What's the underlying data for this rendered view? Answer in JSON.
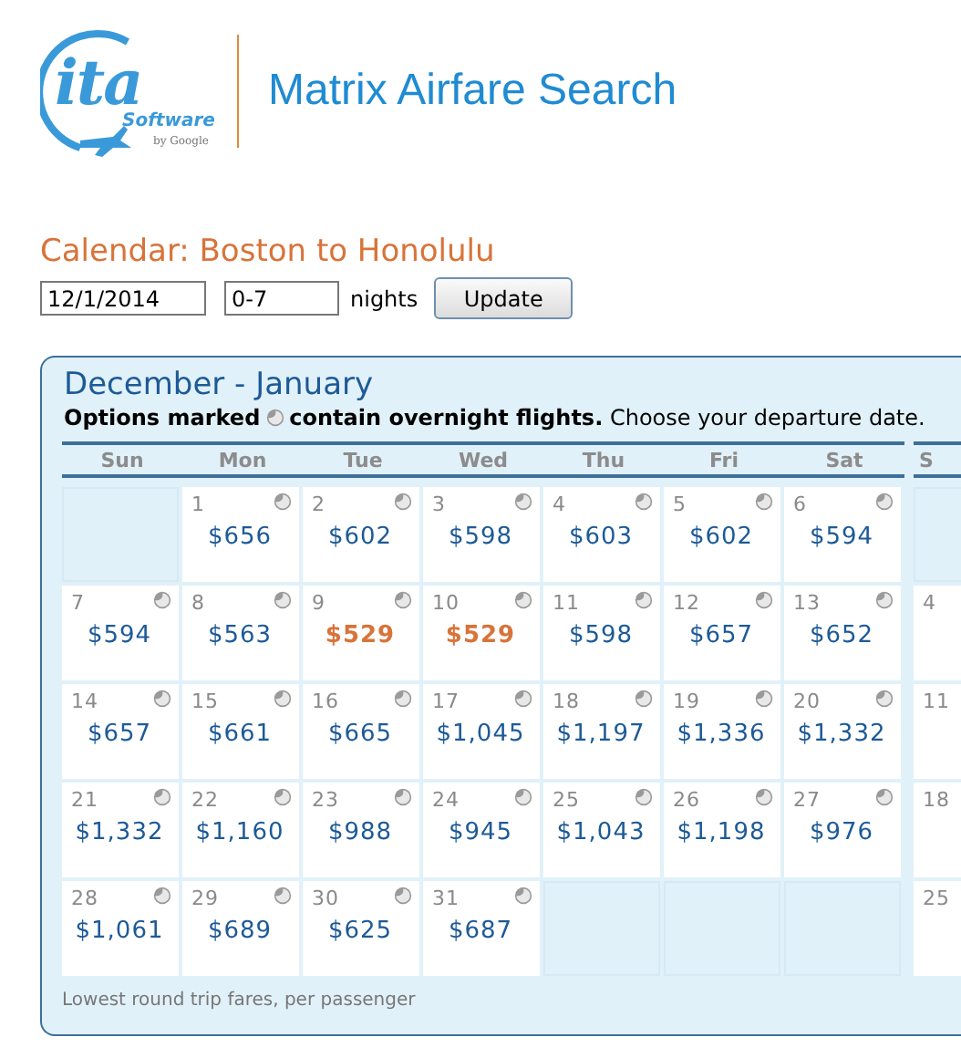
{
  "header": {
    "logo": {
      "wordmark": "ita",
      "product": "Software",
      "owner": "by Google"
    },
    "title": "Matrix Airfare Search"
  },
  "search": {
    "heading": "Calendar: Boston to Honolulu",
    "date": "12/1/2014",
    "nights": "0-7",
    "nights_label": "nights",
    "button": "Update"
  },
  "calendar": {
    "title": "December - January",
    "legend": {
      "lead": "Options marked",
      "rest": "**contain overnight flights.** Choose your departure date."
    },
    "weekdays": [
      "Sun",
      "Mon",
      "Tue",
      "Wed",
      "Thu",
      "Fri",
      "Sat"
    ],
    "weeks": [
      [
        {
          "kind": "blank"
        },
        {
          "kind": "date",
          "day": "1",
          "price": "$656",
          "overnight": true,
          "lowest": false
        },
        {
          "kind": "date",
          "day": "2",
          "price": "$602",
          "overnight": true,
          "lowest": false
        },
        {
          "kind": "date",
          "day": "3",
          "price": "$598",
          "overnight": true,
          "lowest": false
        },
        {
          "kind": "date",
          "day": "4",
          "price": "$603",
          "overnight": true,
          "lowest": false
        },
        {
          "kind": "date",
          "day": "5",
          "price": "$602",
          "overnight": true,
          "lowest": false
        },
        {
          "kind": "date",
          "day": "6",
          "price": "$594",
          "overnight": true,
          "lowest": false
        }
      ],
      [
        {
          "kind": "date",
          "day": "7",
          "price": "$594",
          "overnight": true,
          "lowest": false
        },
        {
          "kind": "date",
          "day": "8",
          "price": "$563",
          "overnight": true,
          "lowest": false
        },
        {
          "kind": "date",
          "day": "9",
          "price": "$529",
          "overnight": true,
          "lowest": true
        },
        {
          "kind": "date",
          "day": "10",
          "price": "$529",
          "overnight": true,
          "lowest": true
        },
        {
          "kind": "date",
          "day": "11",
          "price": "$598",
          "overnight": true,
          "lowest": false
        },
        {
          "kind": "date",
          "day": "12",
          "price": "$657",
          "overnight": true,
          "lowest": false
        },
        {
          "kind": "date",
          "day": "13",
          "price": "$652",
          "overnight": true,
          "lowest": false
        }
      ],
      [
        {
          "kind": "date",
          "day": "14",
          "price": "$657",
          "overnight": true,
          "lowest": false
        },
        {
          "kind": "date",
          "day": "15",
          "price": "$661",
          "overnight": true,
          "lowest": false
        },
        {
          "kind": "date",
          "day": "16",
          "price": "$665",
          "overnight": true,
          "lowest": false
        },
        {
          "kind": "date",
          "day": "17",
          "price": "$1,045",
          "overnight": true,
          "lowest": false
        },
        {
          "kind": "date",
          "day": "18",
          "price": "$1,197",
          "overnight": true,
          "lowest": false
        },
        {
          "kind": "date",
          "day": "19",
          "price": "$1,336",
          "overnight": true,
          "lowest": false
        },
        {
          "kind": "date",
          "day": "20",
          "price": "$1,332",
          "overnight": true,
          "lowest": false
        }
      ],
      [
        {
          "kind": "date",
          "day": "21",
          "price": "$1,332",
          "overnight": true,
          "lowest": false
        },
        {
          "kind": "date",
          "day": "22",
          "price": "$1,160",
          "overnight": true,
          "lowest": false
        },
        {
          "kind": "date",
          "day": "23",
          "price": "$988",
          "overnight": true,
          "lowest": false
        },
        {
          "kind": "date",
          "day": "24",
          "price": "$945",
          "overnight": true,
          "lowest": false
        },
        {
          "kind": "date",
          "day": "25",
          "price": "$1,043",
          "overnight": true,
          "lowest": false
        },
        {
          "kind": "date",
          "day": "26",
          "price": "$1,198",
          "overnight": true,
          "lowest": false
        },
        {
          "kind": "date",
          "day": "27",
          "price": "$976",
          "overnight": true,
          "lowest": false
        }
      ],
      [
        {
          "kind": "date",
          "day": "28",
          "price": "$1,061",
          "overnight": true,
          "lowest": false
        },
        {
          "kind": "date",
          "day": "29",
          "price": "$689",
          "overnight": true,
          "lowest": false
        },
        {
          "kind": "date",
          "day": "30",
          "price": "$625",
          "overnight": true,
          "lowest": false
        },
        {
          "kind": "date",
          "day": "31",
          "price": "$687",
          "overnight": true,
          "lowest": false
        },
        {
          "kind": "blank"
        },
        {
          "kind": "blank"
        },
        {
          "kind": "blank"
        }
      ]
    ],
    "next_month": {
      "weekday": "S",
      "days": [
        {
          "kind": "blank"
        },
        {
          "kind": "date",
          "day": "4"
        },
        {
          "kind": "date",
          "day": "11"
        },
        {
          "kind": "date",
          "day": "18"
        },
        {
          "kind": "date",
          "day": "25"
        }
      ]
    },
    "footer": "Lowest round trip fares, per passenger"
  }
}
